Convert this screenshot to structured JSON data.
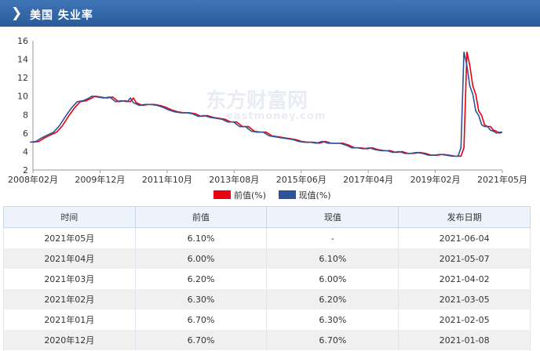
{
  "header": {
    "title": "美国  失业率"
  },
  "watermark": {
    "brand": "东方财富网",
    "domain": "eastmoney.com"
  },
  "chart_data": {
    "type": "line",
    "ylim": [
      2,
      16
    ],
    "yticks": [
      2,
      4,
      6,
      8,
      10,
      12,
      14,
      16
    ],
    "xticks": [
      "2008年02月",
      "2009年12月",
      "2011年10月",
      "2013年08月",
      "2015年06月",
      "2017年04月",
      "2019年02月",
      "2021年05月"
    ],
    "legend_position": "bottom",
    "series": [
      {
        "name": "前值(%)",
        "color": "#e60012"
      },
      {
        "name": "现值(%)",
        "color": "#2d5496"
      }
    ],
    "current_points": [
      [
        "2008-01",
        5.0
      ],
      [
        "2008-03",
        5.1
      ],
      [
        "2008-05",
        5.5
      ],
      [
        "2008-07",
        5.8
      ],
      [
        "2008-09",
        6.1
      ],
      [
        "2008-11",
        6.8
      ],
      [
        "2009-01",
        7.8
      ],
      [
        "2009-03",
        8.7
      ],
      [
        "2009-05",
        9.4
      ],
      [
        "2009-07",
        9.5
      ],
      [
        "2009-09",
        9.8
      ],
      [
        "2009-10",
        10.0
      ],
      [
        "2009-12",
        9.9
      ],
      [
        "2010-02",
        9.8
      ],
      [
        "2010-04",
        9.9
      ],
      [
        "2010-06",
        9.4
      ],
      [
        "2010-08",
        9.5
      ],
      [
        "2010-10",
        9.4
      ],
      [
        "2010-11",
        9.8
      ],
      [
        "2010-12",
        9.3
      ],
      [
        "2011-02",
        9.0
      ],
      [
        "2011-04",
        9.1
      ],
      [
        "2011-06",
        9.1
      ],
      [
        "2011-08",
        9.0
      ],
      [
        "2011-10",
        8.8
      ],
      [
        "2011-12",
        8.5
      ],
      [
        "2012-02",
        8.3
      ],
      [
        "2012-04",
        8.2
      ],
      [
        "2012-06",
        8.2
      ],
      [
        "2012-08",
        8.1
      ],
      [
        "2012-10",
        7.8
      ],
      [
        "2012-12",
        7.9
      ],
      [
        "2013-02",
        7.7
      ],
      [
        "2013-04",
        7.6
      ],
      [
        "2013-06",
        7.5
      ],
      [
        "2013-08",
        7.2
      ],
      [
        "2013-10",
        7.2
      ],
      [
        "2013-12",
        6.7
      ],
      [
        "2014-02",
        6.7
      ],
      [
        "2014-04",
        6.2
      ],
      [
        "2014-06",
        6.1
      ],
      [
        "2014-08",
        6.1
      ],
      [
        "2014-10",
        5.7
      ],
      [
        "2014-12",
        5.6
      ],
      [
        "2015-02",
        5.5
      ],
      [
        "2015-04",
        5.4
      ],
      [
        "2015-06",
        5.3
      ],
      [
        "2015-08",
        5.1
      ],
      [
        "2015-10",
        5.0
      ],
      [
        "2015-12",
        5.0
      ],
      [
        "2016-02",
        4.9
      ],
      [
        "2016-04",
        5.1
      ],
      [
        "2016-06",
        4.9
      ],
      [
        "2016-08",
        4.9
      ],
      [
        "2016-10",
        4.9
      ],
      [
        "2016-12",
        4.7
      ],
      [
        "2017-02",
        4.4
      ],
      [
        "2017-04",
        4.4
      ],
      [
        "2017-06",
        4.3
      ],
      [
        "2017-08",
        4.4
      ],
      [
        "2017-10",
        4.2
      ],
      [
        "2017-12",
        4.1
      ],
      [
        "2018-02",
        4.1
      ],
      [
        "2018-04",
        3.9
      ],
      [
        "2018-06",
        4.0
      ],
      [
        "2018-08",
        3.8
      ],
      [
        "2018-10",
        3.8
      ],
      [
        "2018-12",
        3.9
      ],
      [
        "2019-02",
        3.8
      ],
      [
        "2019-04",
        3.6
      ],
      [
        "2019-06",
        3.6
      ],
      [
        "2019-08",
        3.7
      ],
      [
        "2019-10",
        3.6
      ],
      [
        "2019-12",
        3.5
      ],
      [
        "2020-02",
        3.5
      ],
      [
        "2020-03",
        4.4
      ],
      [
        "2020-04",
        14.8
      ],
      [
        "2020-05",
        13.3
      ],
      [
        "2020-06",
        11.1
      ],
      [
        "2020-07",
        10.2
      ],
      [
        "2020-08",
        8.4
      ],
      [
        "2020-09",
        7.9
      ],
      [
        "2020-10",
        6.9
      ],
      [
        "2020-11",
        6.7
      ],
      [
        "2020-12",
        6.7
      ],
      [
        "2021-01",
        6.3
      ],
      [
        "2021-02",
        6.2
      ],
      [
        "2021-03",
        6.0
      ],
      [
        "2021-04",
        6.1
      ],
      [
        "2021-05",
        6.1
      ]
    ]
  },
  "table": {
    "headers": [
      "时间",
      "前值",
      "现值",
      "发布日期"
    ],
    "rows": [
      [
        "2021年05月",
        "6.10%",
        "-",
        "2021-06-04"
      ],
      [
        "2021年04月",
        "6.00%",
        "6.10%",
        "2021-05-07"
      ],
      [
        "2021年03月",
        "6.20%",
        "6.00%",
        "2021-04-02"
      ],
      [
        "2021年02月",
        "6.30%",
        "6.20%",
        "2021-03-05"
      ],
      [
        "2021年01月",
        "6.70%",
        "6.30%",
        "2021-02-05"
      ],
      [
        "2020年12月",
        "6.70%",
        "6.70%",
        "2021-01-08"
      ]
    ]
  }
}
